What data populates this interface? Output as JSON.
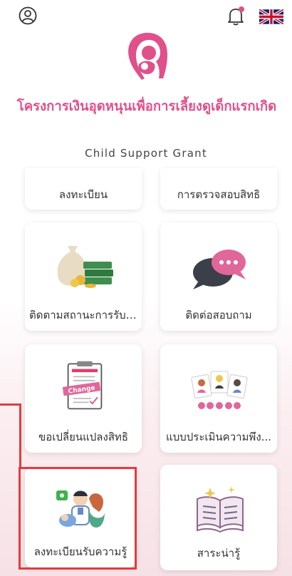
{
  "header": {
    "title": "โครงการเงินอุดหนุนเพื่อการเลี้ยงดูเด็กแรกเกิด",
    "subtitle": "Child Support Grant"
  },
  "menu": {
    "register": "ลงทะเบียน",
    "check_rights": "การตรวจสอบสิทธิ",
    "track_status": "ติดตามสถานะการรับเ...",
    "contact": "ติดต่อสอบถาม",
    "change_rights": "ขอเปลี่ยนแปลงสิทธิ",
    "survey": "แบบประเมินความพึง...",
    "register_knowledge": "ลงทะเบียนรับความรู้",
    "knowledge": "สาระน่ารู้"
  },
  "icons": {
    "change_badge": "Change"
  },
  "colors": {
    "accent": "#e0508a",
    "highlight": "#e23c3c"
  }
}
